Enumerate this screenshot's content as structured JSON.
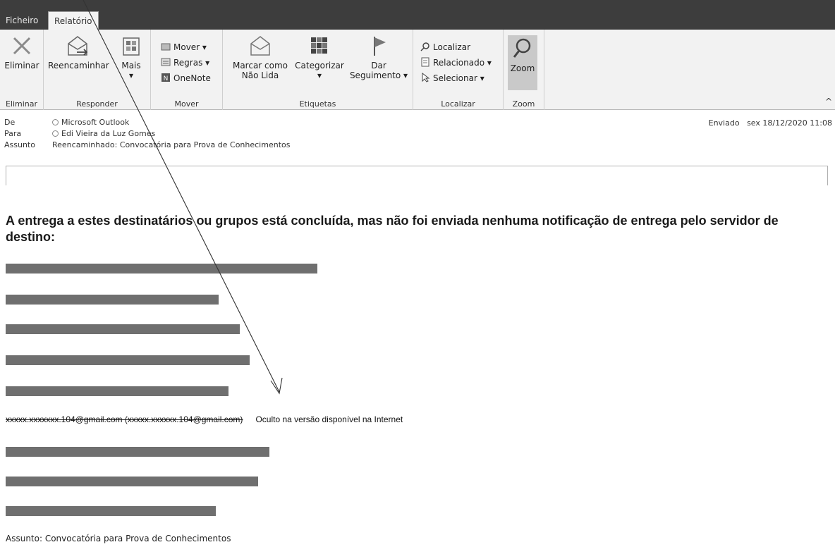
{
  "tabs": {
    "file": "Ficheiro",
    "report": "Relatório"
  },
  "ribbon": {
    "delete": {
      "button": "Eliminar",
      "group": "Eliminar"
    },
    "respond": {
      "forward": "Reencaminhar",
      "more": "Mais",
      "more_arrow": "▾",
      "group": "Responder"
    },
    "move": {
      "move": "Mover ▾",
      "rules": "Regras ▾",
      "onenote": "OneNote",
      "group": "Mover"
    },
    "tags": {
      "mark_unread_1": "Marcar como",
      "mark_unread_2": "Não Lida",
      "categorize": "Categorizar",
      "categorize_arrow": "▾",
      "follow_1": "Dar",
      "follow_2": "Seguimento ▾",
      "group": "Etiquetas"
    },
    "find": {
      "find": "Localizar",
      "related": "Relacionado ▾",
      "select": "Selecionar ▾",
      "group": "Localizar"
    },
    "zoom": {
      "button": "Zoom",
      "group": "Zoom"
    },
    "collapse": "^"
  },
  "header": {
    "from_label": "De",
    "from_value": "Microsoft Outlook",
    "to_label": "Para",
    "to_value": "Edi Vieira da Luz Gomes",
    "subject_label": "Assunto",
    "subject_value": "Reencaminhado: Convocatória para Prova de Conhecimentos",
    "sent_label": "Enviado",
    "sent_value": "sex 18/12/2020 11:08"
  },
  "body": {
    "heading": "A entrega a estes destinatários ou grupos está concluída, mas não foi enviada nenhuma notificação de entrega pelo servidor de destino:",
    "visible_address": "xxxxx.xxxxxxx.104@gmail.com (xxxxx.xxxxxx.104@gmail.com)",
    "hidden_note": "Oculto na versão disponível na Internet",
    "subject_line": "Assunto: Convocatória para Prova de Conhecimentos"
  },
  "colors": {
    "tabbar": "#3d3d3d",
    "ribbon": "#f2f2f2",
    "redaction": "#6f6f6f",
    "zoom_highlight": "#c9c9c9"
  }
}
